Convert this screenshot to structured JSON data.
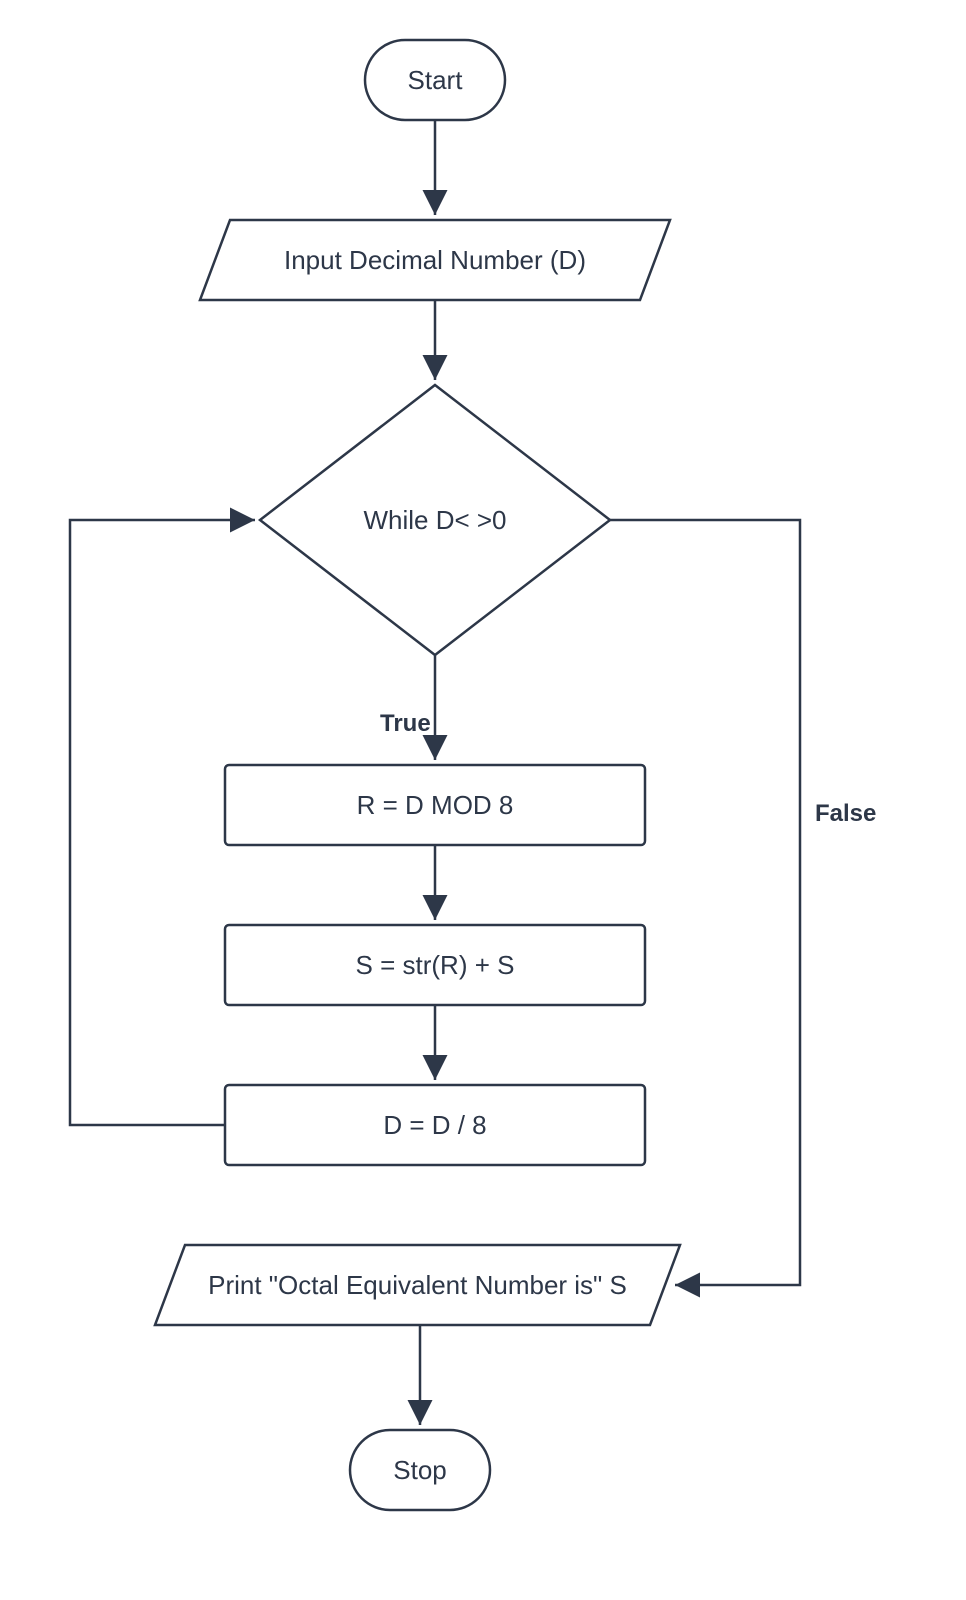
{
  "flowchart": {
    "nodes": {
      "start": "Start",
      "input": "Input  Decimal Number (D)",
      "decision": "While  D< >0",
      "proc1": "R = D MOD 8",
      "proc2": "S = str(R) + S",
      "proc3": "D = D / 8",
      "output": "Print \"Octal Equivalent Number is\"  S",
      "stop": "Stop"
    },
    "labels": {
      "true": "True",
      "false": "False"
    }
  },
  "chart_data": {
    "type": "flowchart",
    "description": "Algorithm to convert decimal number to octal equivalent",
    "nodes": [
      {
        "id": "start",
        "type": "terminator",
        "label": "Start"
      },
      {
        "id": "input",
        "type": "io",
        "label": "Input Decimal Number (D)"
      },
      {
        "id": "decision",
        "type": "decision",
        "label": "While D< >0"
      },
      {
        "id": "proc1",
        "type": "process",
        "label": "R = D MOD 8"
      },
      {
        "id": "proc2",
        "type": "process",
        "label": "S = str(R) + S"
      },
      {
        "id": "proc3",
        "type": "process",
        "label": "D = D / 8"
      },
      {
        "id": "output",
        "type": "io",
        "label": "Print \"Octal Equivalent Number is\" S"
      },
      {
        "id": "stop",
        "type": "terminator",
        "label": "Stop"
      }
    ],
    "edges": [
      {
        "from": "start",
        "to": "input"
      },
      {
        "from": "input",
        "to": "decision"
      },
      {
        "from": "decision",
        "to": "proc1",
        "label": "True"
      },
      {
        "from": "proc1",
        "to": "proc2"
      },
      {
        "from": "proc2",
        "to": "proc3"
      },
      {
        "from": "proc3",
        "to": "decision"
      },
      {
        "from": "decision",
        "to": "output",
        "label": "False"
      },
      {
        "from": "output",
        "to": "stop"
      }
    ]
  }
}
